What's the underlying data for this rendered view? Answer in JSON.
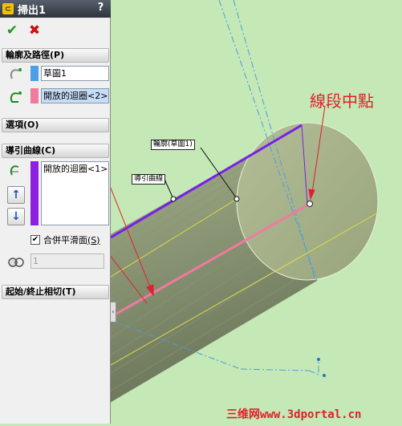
{
  "panel": {
    "title": "掃出1",
    "title_icon": "sweep-feature-icon",
    "help_label": "?",
    "ok_icon": "check-icon",
    "cancel_icon": "cross-icon",
    "sections": {
      "profile_path": {
        "header": "輪廓及路徑(P)",
        "profile_value": "草圖1",
        "path_value": "開放的迴圈<2>"
      },
      "options": {
        "header": "選項(O)"
      },
      "guide_curves": {
        "header": "導引曲線(C)",
        "list_item": "開放的迴圈<1>",
        "merge_checkbox_label": "合併平滑面",
        "merge_checkbox_shortcut": "(S)",
        "merge_checked": true,
        "index_value": "1"
      },
      "start_end": {
        "header": "起始/終止相切(T)"
      }
    }
  },
  "viewport": {
    "profile_tag": "輪廓(草圖1)",
    "guide_tag": "導引曲線",
    "callout_text": "線段中點",
    "watermark": "三维网www.3dportal.cn"
  },
  "colors": {
    "profile_swatch": "#4aa0e6",
    "path_swatch": "#f07aa0",
    "guide_swatch": "#8c1fe0",
    "background": "#c4e8b6",
    "annotation": "#e0202a"
  }
}
